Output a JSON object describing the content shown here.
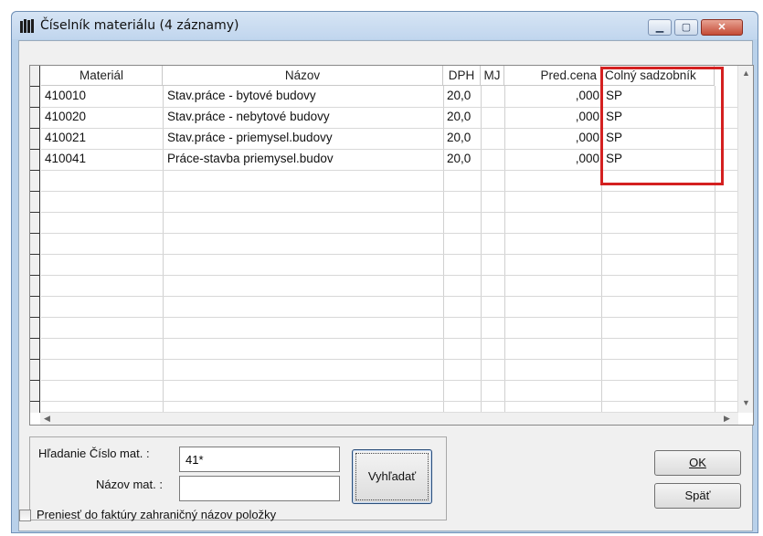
{
  "window": {
    "title": "Číselník materiálu (4 záznamy)",
    "minimize": "▁",
    "maximize": "▢",
    "close": "✕"
  },
  "grid": {
    "columns": [
      "Materiál",
      "Názov",
      "DPH",
      "MJ",
      "Pred.cena",
      "Colný sadzobník"
    ],
    "rows": [
      {
        "material": "410010",
        "nazov": "Stav.práce - bytové budovy",
        "dph": "20,0",
        "mj": "",
        "cena": ",000",
        "sadzobnik": "SP"
      },
      {
        "material": "410020",
        "nazov": "Stav.práce - nebytové budovy",
        "dph": "20,0",
        "mj": "",
        "cena": ",000",
        "sadzobnik": "SP"
      },
      {
        "material": "410021",
        "nazov": "Stav.práce - priemysel.budovy",
        "dph": "20,0",
        "mj": "",
        "cena": ",000",
        "sadzobnik": "SP"
      },
      {
        "material": "410041",
        "nazov": "Práce-stavba priemysel.budov",
        "dph": "20,0",
        "mj": "",
        "cena": ",000",
        "sadzobnik": "SP"
      }
    ]
  },
  "search": {
    "cislo_label": "Hľadanie Číslo mat. :",
    "cislo_value": "41*",
    "nazov_label": "Názov mat. :",
    "nazov_value": "",
    "button": "Vyhľadať"
  },
  "buttons": {
    "ok": "OK",
    "back": "Späť"
  },
  "checkbox": {
    "label": "Preniesť do faktúry zahraničný názov položky",
    "checked": false
  },
  "colors": {
    "highlight": "#d42020",
    "title_bg": "#c1d6ee"
  }
}
